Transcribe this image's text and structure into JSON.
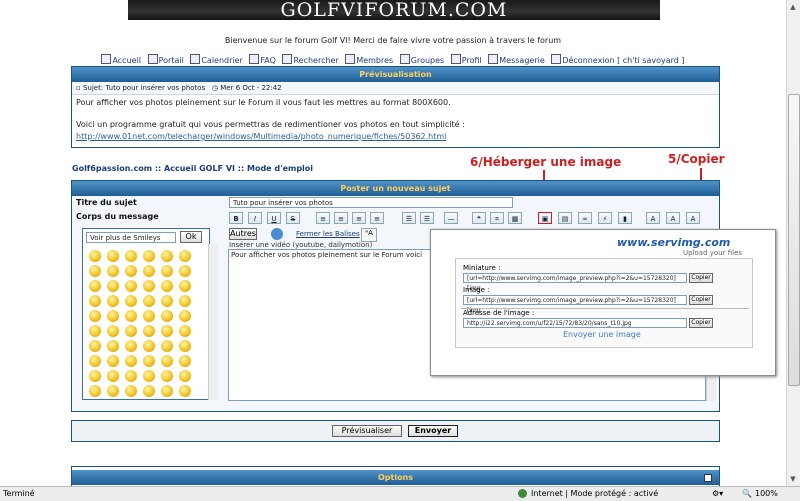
{
  "banner": {
    "title": "GOLFVIFORUM.COM"
  },
  "welcome": "Bienvenue sur le forum Golf VI! Merci de faire vivre votre passion à travers le forum",
  "nav": [
    "Accueil",
    "Portail",
    "Calendrier",
    "FAQ",
    "Rechercher",
    "Membres",
    "Groupes",
    "Profil",
    "Messagerie",
    "Déconnexion [ ch'ti savoyard ]"
  ],
  "preview": {
    "bar_title": "Prévisualisation",
    "subject_line": "Sujet: Tuto pour insérer vos photos",
    "date": "Mer 6 Oct - 22:42",
    "text1": "Pour afficher vos photos pleinement sur le Forum il vous faut les mettres au format 800X600.",
    "text2": "Voici un programme gratuit qui vous permettras de redimentioner vos photos en tout simplicité :",
    "link": "http://www.01net.com/telecharger/windows/Multimedia/photo_numerique/fiches/50362.html"
  },
  "breadcrumb": {
    "site": "Golf6passion.com",
    "sep": "::",
    "cat1": "Accueil GOLF VI",
    "cat2": "Mode d'emploi"
  },
  "annotations": {
    "host": "6/Héberger une image",
    "copy": "5/Copier"
  },
  "post": {
    "bar_title": "Poster un nouveau sujet",
    "subject_label": "Titre du sujet",
    "subject_value": "Tuto pour insérer vos photos",
    "body_label": "Corps du message",
    "smiley_select": "Voir plus de Smileys",
    "ok": "Ok",
    "autres": "Autres",
    "fermer": "Fermer les Balises",
    "video_hint": "Insérer une vidéo (youtube, dailymotion)",
    "body_text": "Pour afficher vos photos pleinement sur le Forum voici"
  },
  "toolbar": [
    "B",
    "I",
    "U",
    "S"
  ],
  "popup": {
    "logo": "www.servimg.com",
    "tagline": "Upload your files",
    "miniature_label": "Miniature :",
    "miniature_value": "[url=http://www.servimg.com/image_preview.php?i=2&u=15728320][img",
    "image_label": "Image :",
    "image_value": "[url=http://www.servimg.com/image_preview.php?i=2&u=15728320][img",
    "address_label": "Adresse de l'image :",
    "address_value": "http://i22.servimg.com/u/f22/15/72/83/20/sans_t10.jpg",
    "copier": "Copier",
    "send_link": "Envoyer une image"
  },
  "buttons": {
    "preview": "Prévisualiser",
    "send": "Envoyer"
  },
  "options": {
    "bar_title": "Options"
  },
  "status": {
    "left": "Terminé",
    "zone": "Internet | Mode protégé : activé",
    "zoom": "100%"
  }
}
